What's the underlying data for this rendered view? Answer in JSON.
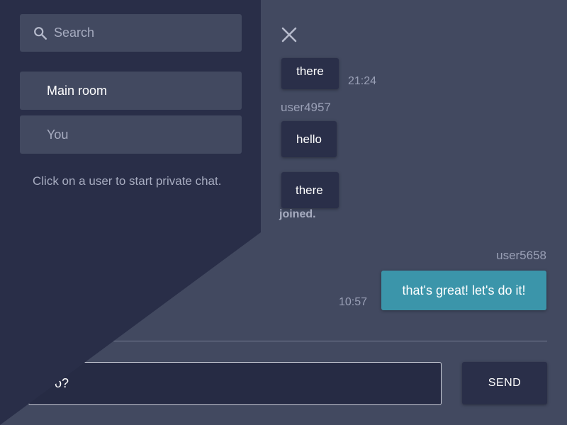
{
  "chat": {
    "messages": [
      {
        "text": "there",
        "time": "21:24"
      },
      {
        "user": "user4957",
        "text": "hello"
      },
      {
        "text": "there"
      }
    ],
    "system_note": "joined.",
    "own_message": {
      "user": "user5658",
      "text": "that's great! let's do it!",
      "time": "10:57"
    },
    "input_value": "o?",
    "send_label": "SEND"
  },
  "sidebar": {
    "search_placeholder": "Search",
    "rooms": [
      "Main room",
      "You"
    ],
    "hint": "Click on a user to start private chat."
  },
  "icons": {
    "close": "close-icon",
    "search": "search-icon"
  },
  "colors": {
    "background": "#424960",
    "sidebar": "#292e48",
    "bubble": "#2a2f49",
    "own_bubble": "#3b95aa"
  }
}
